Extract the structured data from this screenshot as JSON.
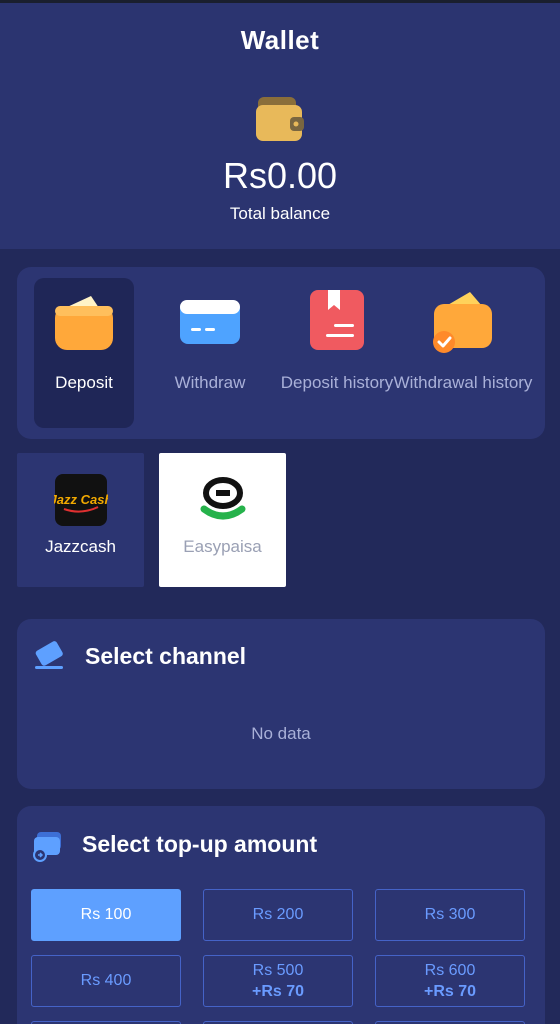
{
  "header": {
    "title": "Wallet",
    "balance": "Rs0.00",
    "balance_label": "Total balance"
  },
  "tabs": [
    {
      "label": "Deposit",
      "icon": "wallet-icon",
      "active": true
    },
    {
      "label": "Withdraw",
      "icon": "card-icon",
      "active": false
    },
    {
      "label": "Deposit history",
      "icon": "receipt-icon",
      "active": false
    },
    {
      "label": "Withdrawal history",
      "icon": "wallet-check-icon",
      "active": false
    }
  ],
  "methods": [
    {
      "label": "Jazzcash",
      "logo_text": "Jazz Cash",
      "selected": true
    },
    {
      "label": "Easypaisa",
      "selected": false
    }
  ],
  "channel": {
    "title": "Select channel",
    "empty_text": "No data"
  },
  "topup": {
    "title": "Select top-up amount",
    "amounts": [
      {
        "value": "Rs 100",
        "bonus": "",
        "selected": true
      },
      {
        "value": "Rs 200",
        "bonus": "",
        "selected": false
      },
      {
        "value": "Rs 300",
        "bonus": "",
        "selected": false
      },
      {
        "value": "Rs 400",
        "bonus": "",
        "selected": false
      },
      {
        "value": "Rs 500",
        "bonus": "+Rs 70",
        "selected": false
      },
      {
        "value": "Rs 600",
        "bonus": "+Rs 70",
        "selected": false
      }
    ]
  },
  "colors": {
    "background": "#22295a",
    "header": "#2b3470",
    "card": "#2c3572",
    "accent": "#5ea0ff",
    "muted_text": "#a9b0d8"
  }
}
